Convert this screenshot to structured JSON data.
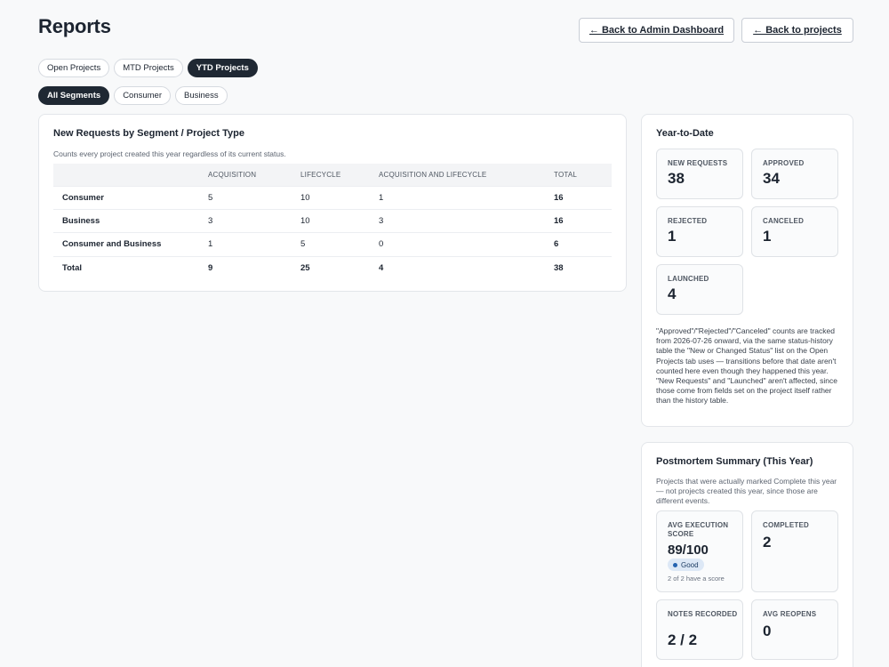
{
  "header": {
    "title": "Reports",
    "back_admin_label": "← Back to Admin Dashboard",
    "back_projects_label": "← Back to projects"
  },
  "period_tabs": [
    {
      "label": "Open Projects",
      "active": false
    },
    {
      "label": "MTD Projects",
      "active": false
    },
    {
      "label": "YTD Projects",
      "active": true
    }
  ],
  "segment_tabs": [
    {
      "label": "All Segments",
      "active": true
    },
    {
      "label": "Consumer",
      "active": false
    },
    {
      "label": "Business",
      "active": false
    }
  ],
  "segment_card": {
    "title": "New Requests by Segment / Project Type",
    "subtitle": "Counts every project created this year regardless of its current status.",
    "columns": [
      "",
      "ACQUISITION",
      "LIFECYCLE",
      "ACQUISITION AND LIFECYCLE",
      "TOTAL"
    ],
    "rows": [
      [
        "Consumer",
        "5",
        "10",
        "1",
        "16"
      ],
      [
        "Business",
        "3",
        "10",
        "3",
        "16"
      ],
      [
        "Consumer and Business",
        "1",
        "5",
        "0",
        "6"
      ],
      [
        "Total",
        "9",
        "25",
        "4",
        "38"
      ]
    ]
  },
  "ytd": {
    "title": "Year-to-Date",
    "stats": {
      "new_requests": {
        "label": "NEW REQUESTS",
        "value": "38"
      },
      "approved": {
        "label": "APPROVED",
        "value": "34"
      },
      "rejected": {
        "label": "REJECTED",
        "value": "1"
      },
      "canceled": {
        "label": "CANCELED",
        "value": "1"
      },
      "launched": {
        "label": "LAUNCHED",
        "value": "4"
      }
    },
    "note": "\"Approved\"/\"Rejected\"/\"Canceled\" counts are tracked from 2026-07-26 onward, via the same status-history table the \"New or Changed Status\" list on the Open Projects tab uses — transitions before that date aren't counted here even though they happened this year. \"New Requests\" and \"Launched\" aren't affected, since those come from fields set on the project itself rather than the history table."
  },
  "postmortem": {
    "title": "Postmortem Summary (This Year)",
    "subtitle": "Projects that were actually marked Complete this year — not projects created this year, since those are different events.",
    "avg_score": {
      "label": "AVG EXECUTION SCORE",
      "value": "89/100",
      "badge": "Good",
      "note": "2 of 2 have a score"
    },
    "completed": {
      "label": "COMPLETED",
      "value": "2"
    },
    "notes": {
      "label": "NOTES RECORDED",
      "value": "2 / 2"
    },
    "reopens": {
      "label": "AVG REOPENS",
      "value": "0"
    }
  },
  "colors": {
    "accent_dark": "#1f2833",
    "badge_bg": "#dde8f6",
    "badge_dot": "#2563b0"
  }
}
